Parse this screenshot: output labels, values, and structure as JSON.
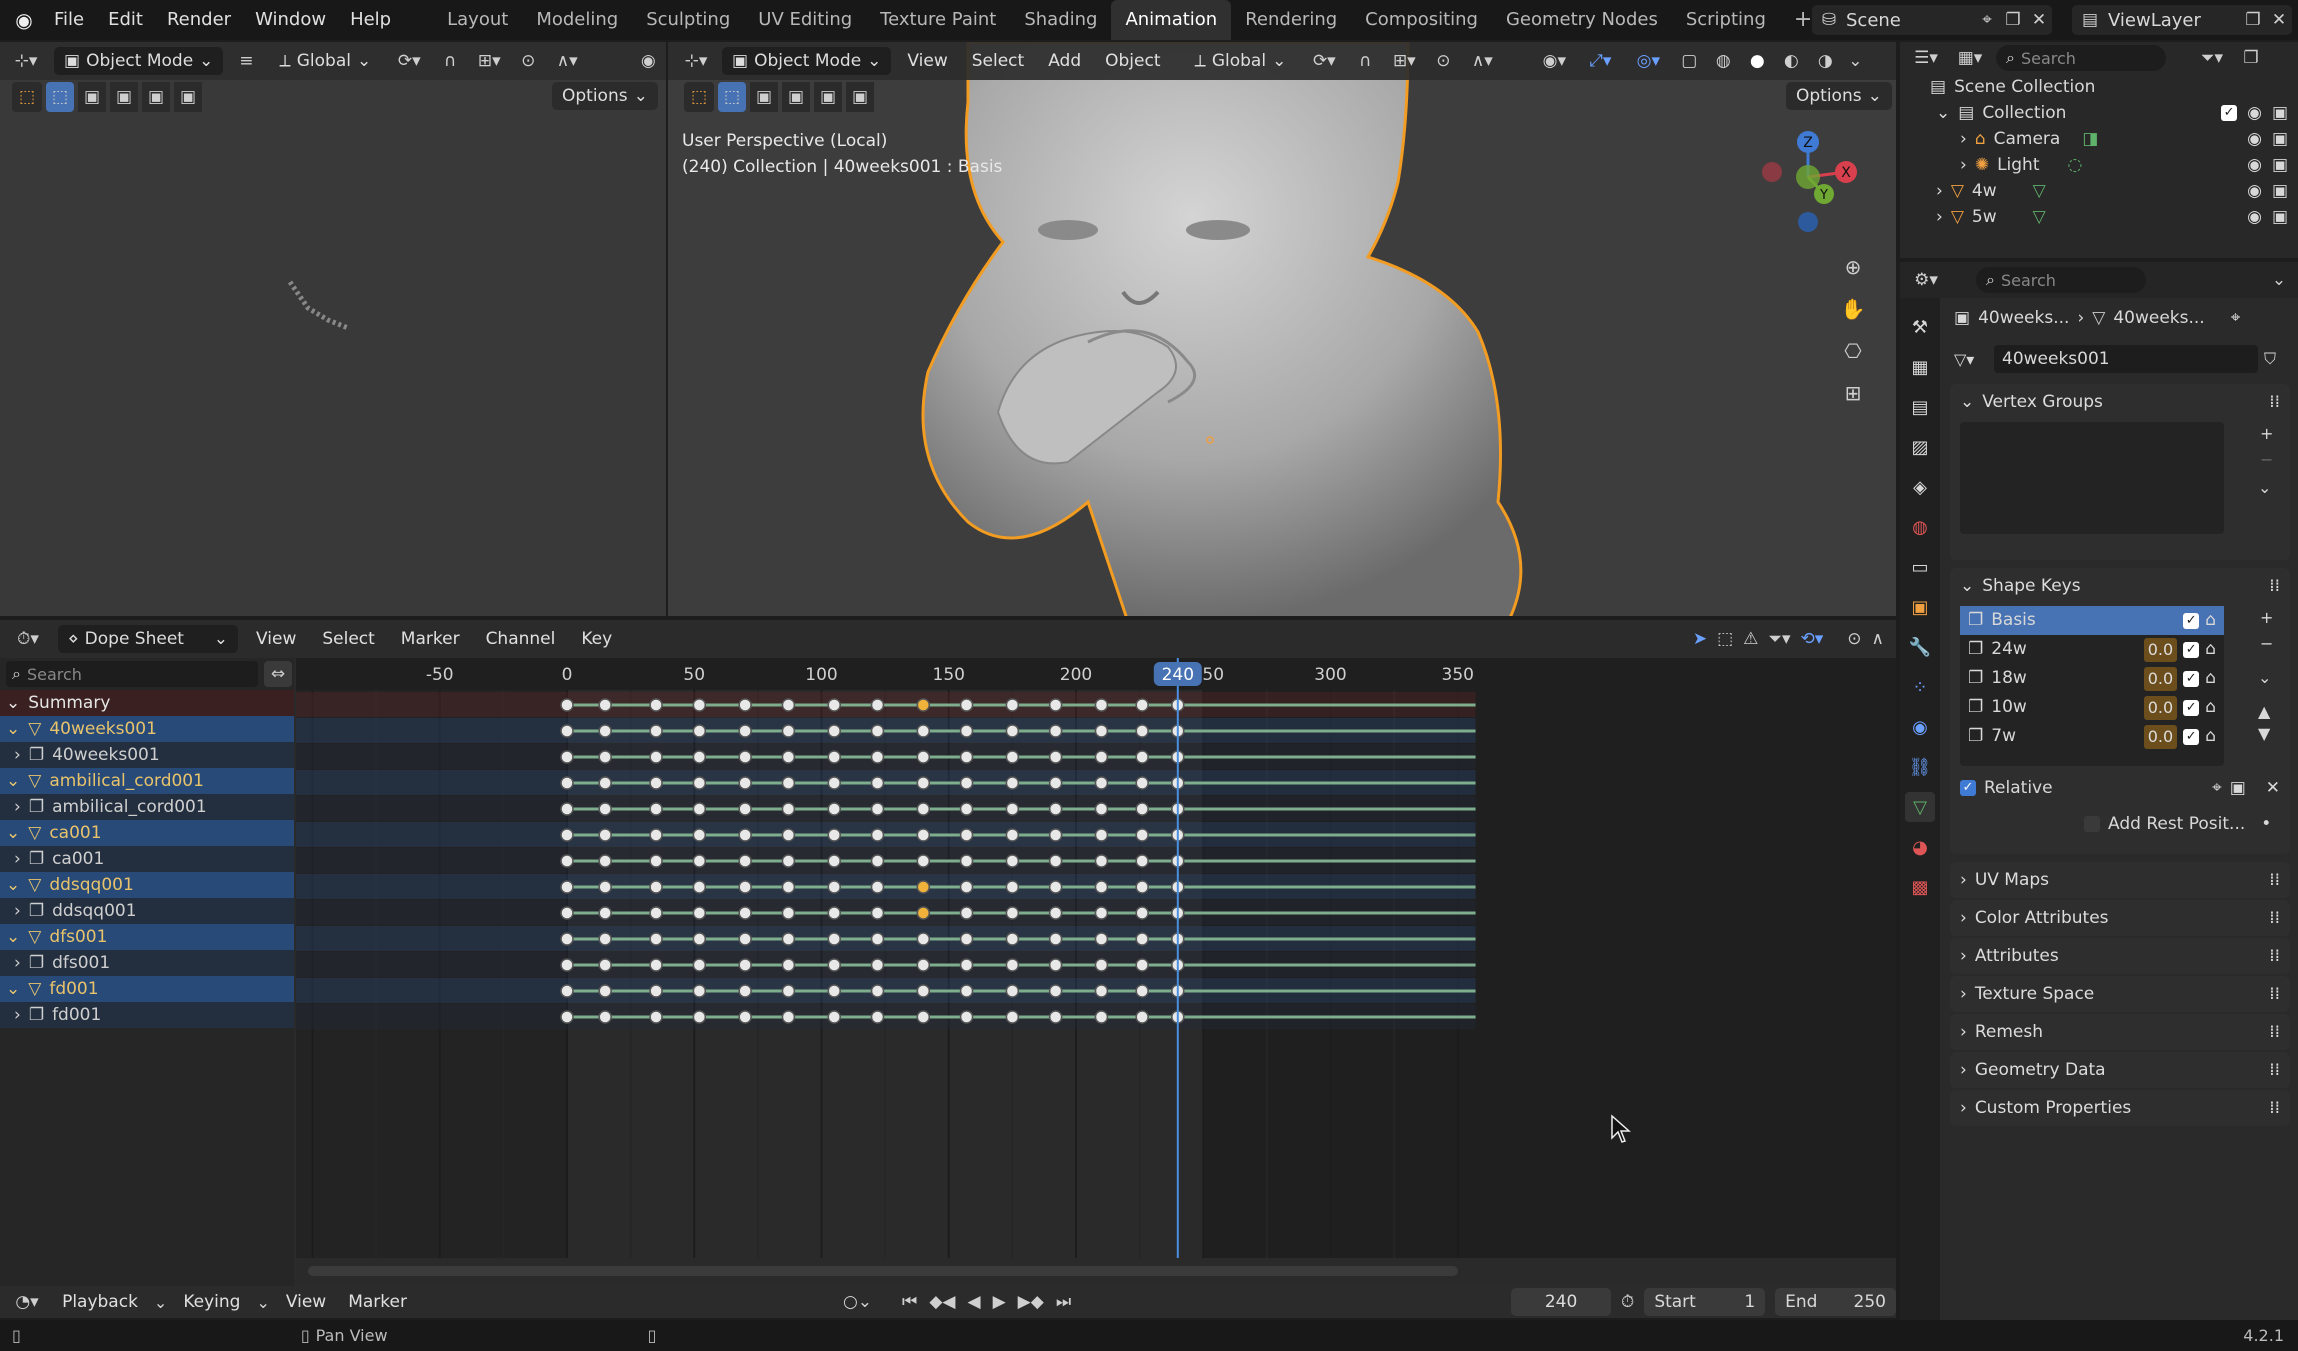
{
  "menubar": {
    "items": [
      "File",
      "Edit",
      "Render",
      "Window",
      "Help"
    ],
    "workspaces": [
      "Layout",
      "Modeling",
      "Sculpting",
      "UV Editing",
      "Texture Paint",
      "Shading",
      "Animation",
      "Rendering",
      "Compositing",
      "Geometry Nodes",
      "Scripting"
    ],
    "active_workspace": "Animation",
    "plus": "+",
    "scene": "Scene",
    "view_layer": "ViewLayer"
  },
  "left_view": {
    "mode": "Object Mode",
    "orientation": "Global",
    "options": "Options"
  },
  "main_view": {
    "mode": "Object Mode",
    "menus": [
      "View",
      "Select",
      "Add",
      "Object"
    ],
    "orientation": "Global",
    "options": "Options",
    "info_line1": "User Perspective (Local)",
    "info_line2": "(240) Collection | 40weeks001 : Basis"
  },
  "gizmo": {
    "z": "Z",
    "x": "X",
    "y": "Y"
  },
  "outliner": {
    "search_placeholder": "Search",
    "scene_collection": "Scene Collection",
    "items": [
      {
        "label": "Collection"
      },
      {
        "label": "Camera"
      },
      {
        "label": "Light"
      },
      {
        "label": "4w"
      },
      {
        "label": "5w"
      }
    ]
  },
  "properties": {
    "search_placeholder": "Search",
    "breadcrumb_a": "40weeks...",
    "breadcrumb_b": "40weeks...",
    "mesh_name": "40weeks001",
    "vertex_groups": "Vertex Groups",
    "shape_keys": "Shape Keys",
    "keys": [
      {
        "name": "Basis",
        "value": ""
      },
      {
        "name": "24w",
        "value": "0.0"
      },
      {
        "name": "18w",
        "value": "0.0"
      },
      {
        "name": "10w",
        "value": "0.0"
      },
      {
        "name": "7w",
        "value": "0.0"
      }
    ],
    "relative": "Relative",
    "add_rest": "Add Rest Posit...",
    "panels": [
      "UV Maps",
      "Color Attributes",
      "Attributes",
      "Texture Space",
      "Remesh",
      "Geometry Data",
      "Custom Properties"
    ]
  },
  "dopesheet": {
    "editor": "Dope Sheet",
    "menus": [
      "View",
      "Select",
      "Marker",
      "Channel",
      "Key"
    ],
    "search_placeholder": "Search",
    "ruler": [
      "-50",
      "0",
      "50",
      "100",
      "150",
      "200",
      "240",
      "50",
      "300",
      "350"
    ],
    "current_frame": "240",
    "channels": [
      {
        "label": "Summary",
        "type": "summary"
      },
      {
        "label": "40weeks001",
        "type": "obj"
      },
      {
        "label": "40weeks001",
        "type": "mesh"
      },
      {
        "label": "ambilical_cord001",
        "type": "obj"
      },
      {
        "label": "ambilical_cord001",
        "type": "mesh"
      },
      {
        "label": "ca001",
        "type": "obj"
      },
      {
        "label": "ca001",
        "type": "mesh"
      },
      {
        "label": "ddsqq001",
        "type": "obj"
      },
      {
        "label": "ddsqq001",
        "type": "mesh"
      },
      {
        "label": "dfs001",
        "type": "obj"
      },
      {
        "label": "dfs001",
        "type": "mesh"
      },
      {
        "label": "fd001",
        "type": "obj"
      },
      {
        "label": "fd001",
        "type": "mesh"
      }
    ],
    "keyframes": [
      0,
      15,
      35,
      52,
      70,
      87,
      105,
      122,
      140,
      157,
      175,
      192,
      210,
      226,
      240
    ],
    "selected_keys": {
      "rows": [
        0,
        7,
        8
      ],
      "frame": 140
    }
  },
  "timeline": {
    "menus": [
      "Playback",
      "Keying",
      "View",
      "Marker"
    ],
    "frame": "240",
    "start_label": "Start",
    "start": "1",
    "end_label": "End",
    "end": "250"
  },
  "statusbar": {
    "pan": "Pan View",
    "version": "4.2.1"
  }
}
